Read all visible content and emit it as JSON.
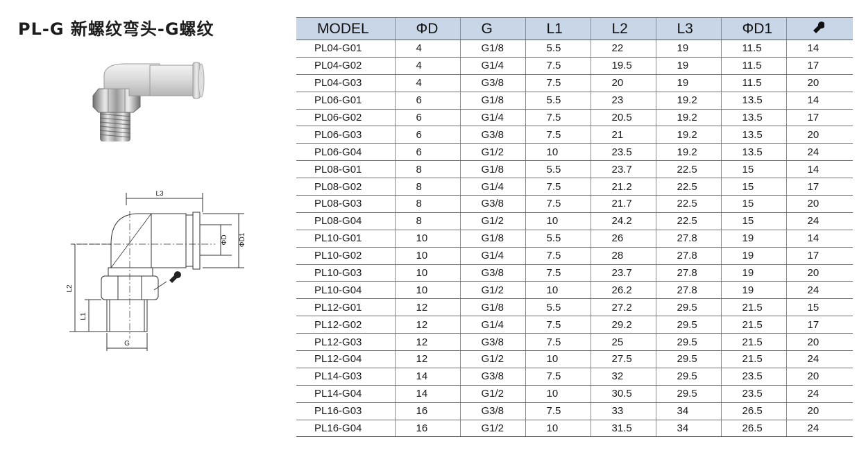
{
  "title": "PL-G 新螺纹弯头-G螺纹",
  "drawing_labels": {
    "l3": "L3",
    "d": "ΦD",
    "d1": "ΦD1",
    "l2": "L2",
    "l1": "L1",
    "g": "G"
  },
  "icons": {
    "photo": "elbow-fitting-photo",
    "drawing": "technical-drawing",
    "wrench": "wrench-icon"
  },
  "table": {
    "headers": [
      "MODEL",
      "ΦD",
      "G",
      "L1",
      "L2",
      "L3",
      "ΦD1"
    ],
    "rows": [
      [
        "PL04-G01",
        "4",
        "G1/8",
        "5.5",
        "22",
        "19",
        "11.5",
        "14"
      ],
      [
        "PL04-G02",
        "4",
        "G1/4",
        "7.5",
        "19.5",
        "19",
        "11.5",
        "17"
      ],
      [
        "PL04-G03",
        "4",
        "G3/8",
        "7.5",
        "20",
        "19",
        "11.5",
        "20"
      ],
      [
        "PL06-G01",
        "6",
        "G1/8",
        "5.5",
        "23",
        "19.2",
        "13.5",
        "14"
      ],
      [
        "PL06-G02",
        "6",
        "G1/4",
        "7.5",
        "20.5",
        "19.2",
        "13.5",
        "17"
      ],
      [
        "PL06-G03",
        "6",
        "G3/8",
        "7.5",
        "21",
        "19.2",
        "13.5",
        "20"
      ],
      [
        "PL06-G04",
        "6",
        "G1/2",
        "10",
        "23.5",
        "19.2",
        "13.5",
        "24"
      ],
      [
        "PL08-G01",
        "8",
        "G1/8",
        "5.5",
        "23.7",
        "22.5",
        "15",
        "14"
      ],
      [
        "PL08-G02",
        "8",
        "G1/4",
        "7.5",
        "21.2",
        "22.5",
        "15",
        "17"
      ],
      [
        "PL08-G03",
        "8",
        "G3/8",
        "7.5",
        "21.7",
        "22.5",
        "15",
        "20"
      ],
      [
        "PL08-G04",
        "8",
        "G1/2",
        "10",
        "24.2",
        "22.5",
        "15",
        "24"
      ],
      [
        "PL10-G01",
        "10",
        "G1/8",
        "5.5",
        "26",
        "27.8",
        "19",
        "14"
      ],
      [
        "PL10-G02",
        "10",
        "G1/4",
        "7.5",
        "28",
        "27.8",
        "19",
        "17"
      ],
      [
        "PL10-G03",
        "10",
        "G3/8",
        "7.5",
        "23.7",
        "27.8",
        "19",
        "20"
      ],
      [
        "PL10-G04",
        "10",
        "G1/2",
        "10",
        "26.2",
        "27.8",
        "19",
        "24"
      ],
      [
        "PL12-G01",
        "12",
        "G1/8",
        "5.5",
        "27.2",
        "29.5",
        "21.5",
        "15"
      ],
      [
        "PL12-G02",
        "12",
        "G1/4",
        "7.5",
        "29.2",
        "29.5",
        "21.5",
        "17"
      ],
      [
        "PL12-G03",
        "12",
        "G3/8",
        "7.5",
        "25",
        "29.5",
        "21.5",
        "20"
      ],
      [
        "PL12-G04",
        "12",
        "G1/2",
        "10",
        "27.5",
        "29.5",
        "21.5",
        "24"
      ],
      [
        "PL14-G03",
        "14",
        "G3/8",
        "7.5",
        "32",
        "29.5",
        "23.5",
        "20"
      ],
      [
        "PL14-G04",
        "14",
        "G1/2",
        "10",
        "30.5",
        "29.5",
        "23.5",
        "24"
      ],
      [
        "PL16-G03",
        "16",
        "G3/8",
        "7.5",
        "33",
        "34",
        "26.5",
        "20"
      ],
      [
        "PL16-G04",
        "16",
        "G1/2",
        "10",
        "31.5",
        "34",
        "26.5",
        "24"
      ]
    ]
  }
}
